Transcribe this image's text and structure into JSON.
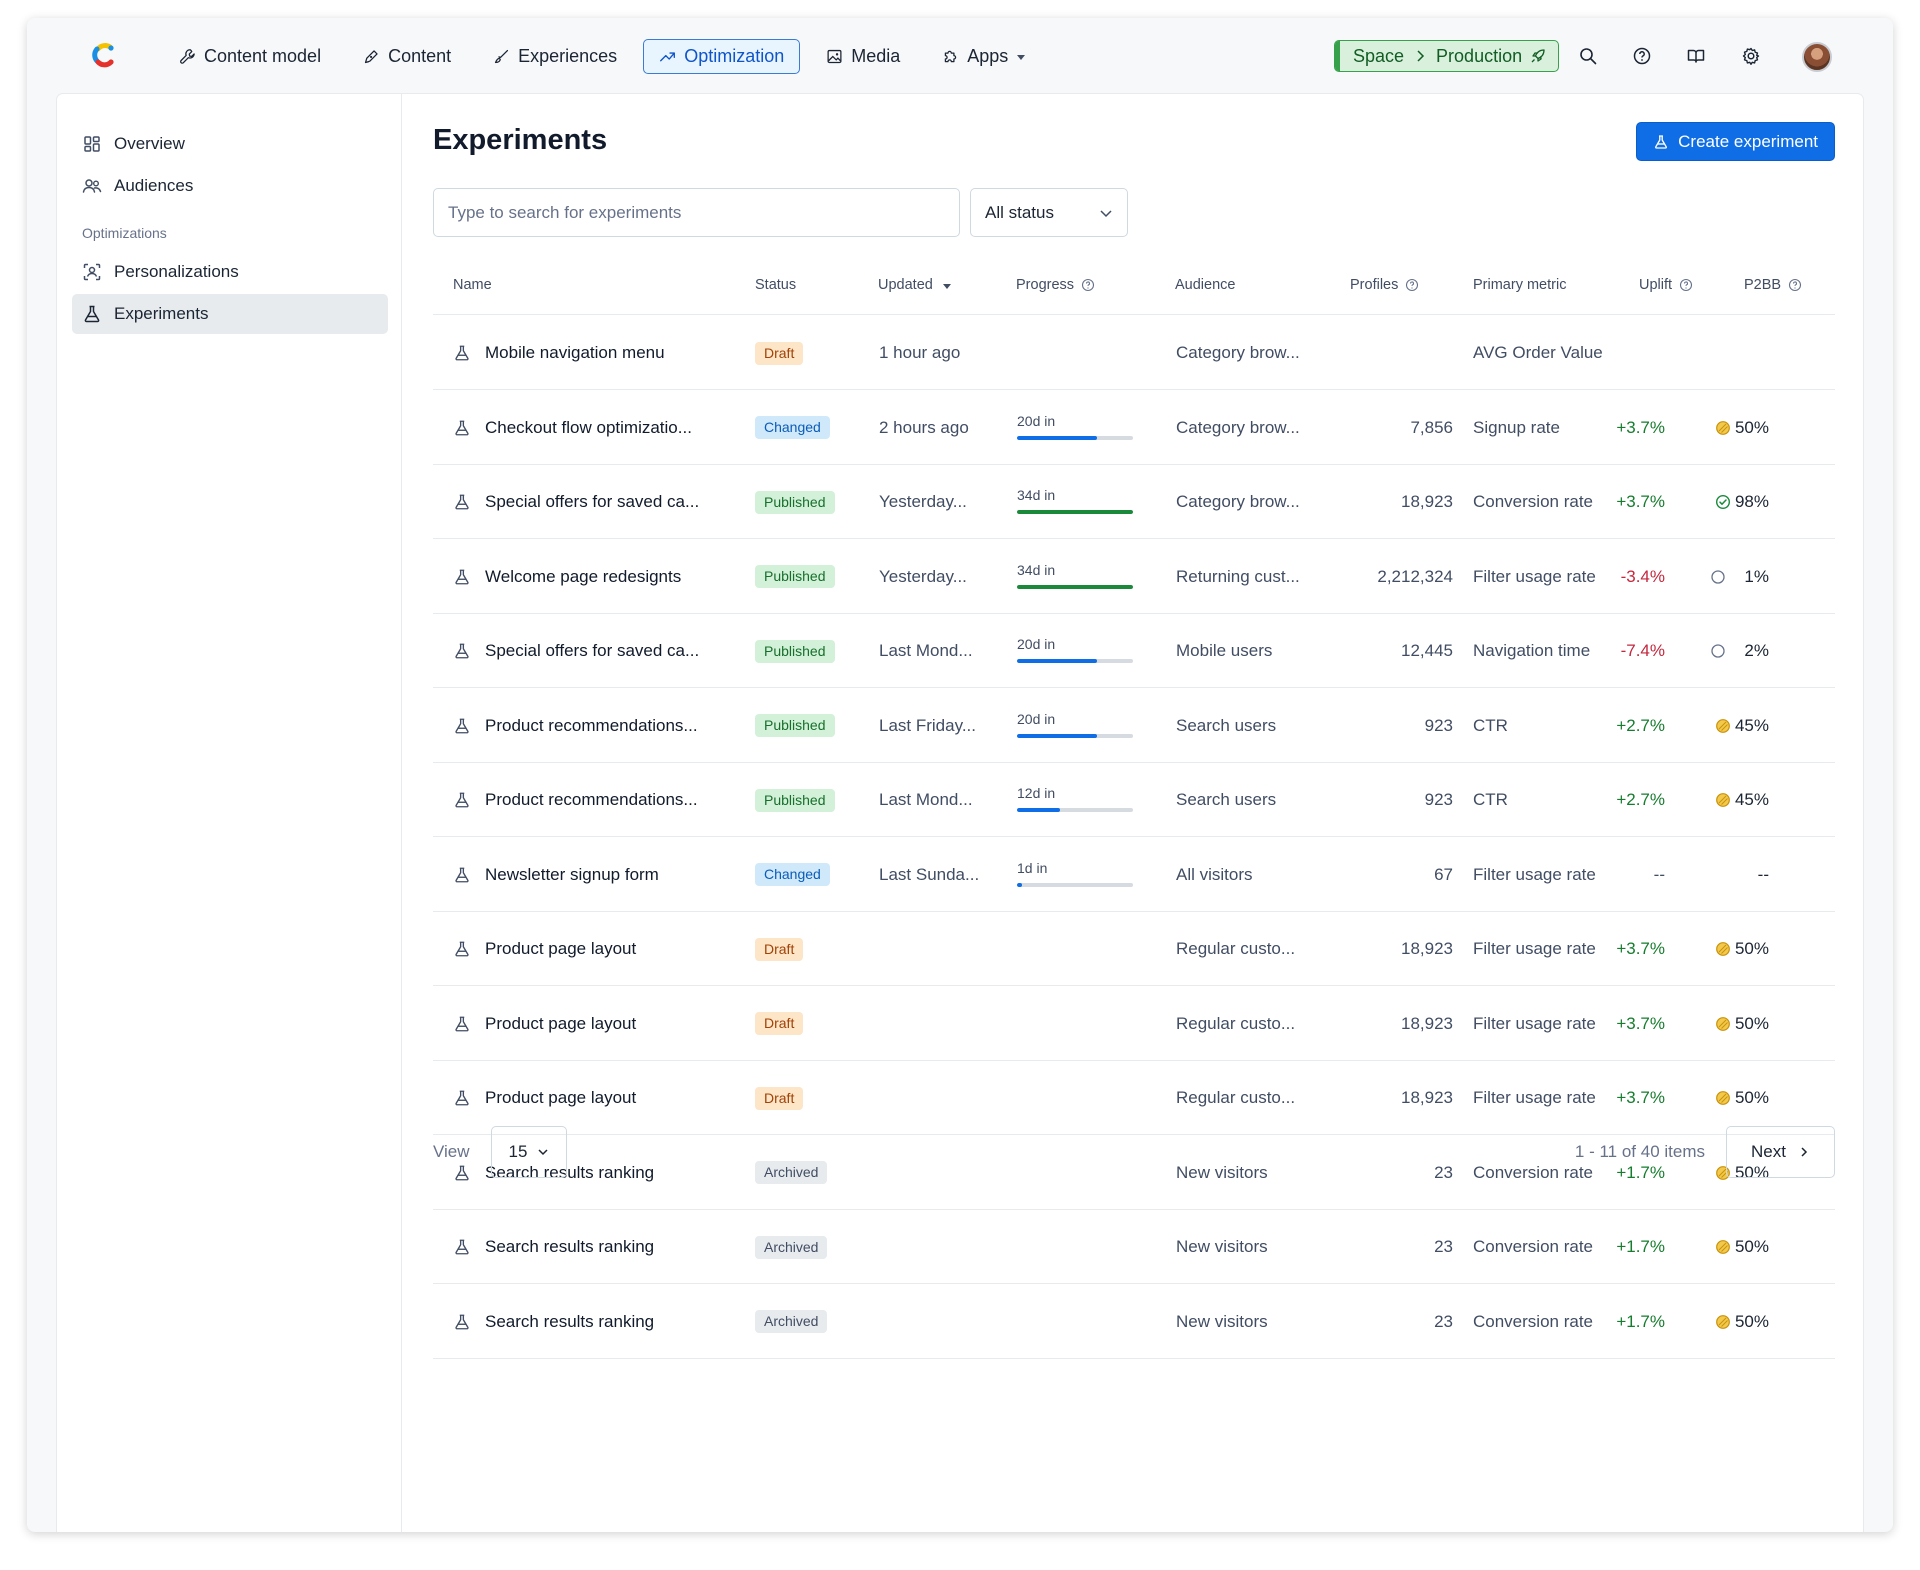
{
  "nav": {
    "items": [
      {
        "label": "Content model",
        "icon": "wrench-icon"
      },
      {
        "label": "Content",
        "icon": "pen-icon"
      },
      {
        "label": "Experiences",
        "icon": "brush-icon"
      },
      {
        "label": "Optimization",
        "icon": "trend-up-icon",
        "active": true
      },
      {
        "label": "Media",
        "icon": "image-icon"
      },
      {
        "label": "Apps",
        "icon": "puzzle-icon",
        "dropdown": true
      }
    ],
    "space": "Space",
    "environment": "Production"
  },
  "colors": {
    "accent": "#0f6ee5",
    "progress_blue": "#0f6ee5",
    "progress_green": "#1a8a3a",
    "positive": "#167d2e",
    "negative": "#c2283e"
  },
  "sidebar": {
    "items": [
      {
        "label": "Overview",
        "icon": "grid-icon"
      },
      {
        "label": "Audiences",
        "icon": "users-icon"
      }
    ],
    "section_label": "Optimizations",
    "section_items": [
      {
        "label": "Personalizations",
        "icon": "target-user-icon"
      },
      {
        "label": "Experiments",
        "icon": "flask-icon",
        "active": true
      }
    ]
  },
  "main": {
    "title": "Experiments",
    "create_button": "Create experiment",
    "search_placeholder": "Type to search for experiments",
    "status_filter": "All status",
    "columns": {
      "name": "Name",
      "status": "Status",
      "updated": "Updated",
      "progress": "Progress",
      "audience": "Audience",
      "profiles": "Profiles",
      "primary_metric": "Primary metric",
      "uplift": "Uplift",
      "p2bb": "P2BB"
    },
    "rows": [
      {
        "name": "Mobile navigation menu",
        "status": "Draft",
        "updated": "1 hour ago",
        "progress_label": "",
        "progress": null,
        "progress_color": "",
        "audience": "Category brow...",
        "profiles": "",
        "metric": "AVG Order Value",
        "uplift": "",
        "uplift_sign": "none",
        "p2bb": "",
        "p2bb_icon": ""
      },
      {
        "name": "Checkout flow optimizatio...",
        "status": "Changed",
        "updated": "2 hours ago",
        "progress_label": "20d in",
        "progress": 0.69,
        "progress_color": "blue",
        "audience": "Category brow...",
        "profiles": "7,856",
        "metric": "Signup rate",
        "uplift": "+3.7%",
        "uplift_sign": "pos",
        "p2bb": "50%",
        "p2bb_icon": "half"
      },
      {
        "name": "Special offers for saved ca...",
        "status": "Published",
        "updated": "Yesterday...",
        "progress_label": "34d in",
        "progress": 1.0,
        "progress_color": "green",
        "audience": "Category brow...",
        "profiles": "18,923",
        "metric": "Conversion rate",
        "uplift": "+3.7%",
        "uplift_sign": "pos",
        "p2bb": "98%",
        "p2bb_icon": "check"
      },
      {
        "name": "Welcome page redesignts",
        "status": "Published",
        "updated": "Yesterday...",
        "progress_label": "34d in",
        "progress": 1.0,
        "progress_color": "green",
        "audience": "Returning cust...",
        "profiles": "2,212,324",
        "metric": "Filter usage rate",
        "uplift": "-3.4%",
        "uplift_sign": "neg",
        "p2bb": "1%",
        "p2bb_icon": "empty"
      },
      {
        "name": "Special offers for saved ca...",
        "status": "Published",
        "updated": "Last Mond...",
        "progress_label": "20d in",
        "progress": 0.69,
        "progress_color": "blue",
        "audience": "Mobile users",
        "profiles": "12,445",
        "metric": "Navigation time",
        "uplift": "-7.4%",
        "uplift_sign": "neg",
        "p2bb": "2%",
        "p2bb_icon": "empty"
      },
      {
        "name": "Product recommendations...",
        "status": "Published",
        "updated": "Last Friday...",
        "progress_label": "20d in",
        "progress": 0.69,
        "progress_color": "blue",
        "audience": "Search users",
        "profiles": "923",
        "metric": "CTR",
        "uplift": "+2.7%",
        "uplift_sign": "pos",
        "p2bb": "45%",
        "p2bb_icon": "half"
      },
      {
        "name": "Product recommendations...",
        "status": "Published",
        "updated": "Last Mond...",
        "progress_label": "12d in",
        "progress": 0.37,
        "progress_color": "blue",
        "audience": "Search users",
        "profiles": "923",
        "metric": "CTR",
        "uplift": "+2.7%",
        "uplift_sign": "pos",
        "p2bb": "45%",
        "p2bb_icon": "half"
      },
      {
        "name": "Newsletter signup form",
        "status": "Changed",
        "updated": "Last Sunda...",
        "progress_label": "1d in",
        "progress": 0.04,
        "progress_color": "blue",
        "audience": "All visitors",
        "profiles": "67",
        "metric": "Filter usage rate",
        "uplift": "--",
        "uplift_sign": "none",
        "p2bb": "--",
        "p2bb_icon": ""
      },
      {
        "name": "Product page layout",
        "status": "Draft",
        "updated": "",
        "progress_label": "",
        "progress": null,
        "progress_color": "",
        "audience": "Regular custo...",
        "profiles": "18,923",
        "metric": "Filter usage rate",
        "uplift": "+3.7%",
        "uplift_sign": "pos",
        "p2bb": "50%",
        "p2bb_icon": "half"
      },
      {
        "name": "Product page layout",
        "status": "Draft",
        "updated": "",
        "progress_label": "",
        "progress": null,
        "progress_color": "",
        "audience": "Regular custo...",
        "profiles": "18,923",
        "metric": "Filter usage rate",
        "uplift": "+3.7%",
        "uplift_sign": "pos",
        "p2bb": "50%",
        "p2bb_icon": "half"
      },
      {
        "name": "Product page layout",
        "status": "Draft",
        "updated": "",
        "progress_label": "",
        "progress": null,
        "progress_color": "",
        "audience": "Regular custo...",
        "profiles": "18,923",
        "metric": "Filter usage rate",
        "uplift": "+3.7%",
        "uplift_sign": "pos",
        "p2bb": "50%",
        "p2bb_icon": "half"
      },
      {
        "name": "Search results ranking",
        "status": "Archived",
        "updated": "",
        "progress_label": "",
        "progress": null,
        "progress_color": "",
        "audience": "New visitors",
        "profiles": "23",
        "metric": "Conversion rate",
        "uplift": "+1.7%",
        "uplift_sign": "pos",
        "p2bb": "50%",
        "p2bb_icon": "half"
      },
      {
        "name": "Search results ranking",
        "status": "Archived",
        "updated": "",
        "progress_label": "",
        "progress": null,
        "progress_color": "",
        "audience": "New visitors",
        "profiles": "23",
        "metric": "Conversion rate",
        "uplift": "+1.7%",
        "uplift_sign": "pos",
        "p2bb": "50%",
        "p2bb_icon": "half"
      },
      {
        "name": "Search results ranking",
        "status": "Archived",
        "updated": "",
        "progress_label": "",
        "progress": null,
        "progress_color": "",
        "audience": "New visitors",
        "profiles": "23",
        "metric": "Conversion rate",
        "uplift": "+1.7%",
        "uplift_sign": "pos",
        "p2bb": "50%",
        "p2bb_icon": "half"
      }
    ],
    "pagination": {
      "view_label": "View",
      "page_size": "15",
      "info": "1 - 11 of 40 items",
      "next": "Next"
    }
  }
}
